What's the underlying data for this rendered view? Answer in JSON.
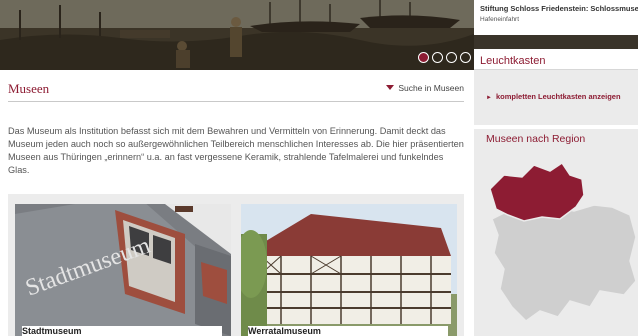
{
  "hero": {
    "caption_title": "Stiftung Schloss Friedenstein: Schlossmuseum",
    "caption_subtitle": "Hafeneinfahrt",
    "slides": [
      true,
      false,
      false,
      false
    ]
  },
  "sidebar": {
    "lightbox_title": "Leuchtkasten",
    "lightbox_link": "kompletten Leuchtkasten anzeigen",
    "region_title": "Museen nach Region",
    "colors": {
      "accent": "#8d1c33",
      "region_inactive": "#cfcfcf"
    }
  },
  "main": {
    "title": "Museen",
    "search_label": "Suche in Museen",
    "intro": "Das Museum als Institution befasst sich mit dem Bewahren und Vermitteln von Erinnerung. Damit deckt das Museum jeden auch noch so außergewöhnlichen Teilbereich menschlichen Interesses ab. Die hier präsentierten Museen aus Thüringen „erinnern“ u.a. an fast vergessene Keramik, strahlende Tafelmalerei und funkelndes Glas.",
    "cards": [
      {
        "label": "Stadtmuseum",
        "sign_text": "Stadtmuseum"
      },
      {
        "label": "Werratalmuseum"
      }
    ]
  }
}
